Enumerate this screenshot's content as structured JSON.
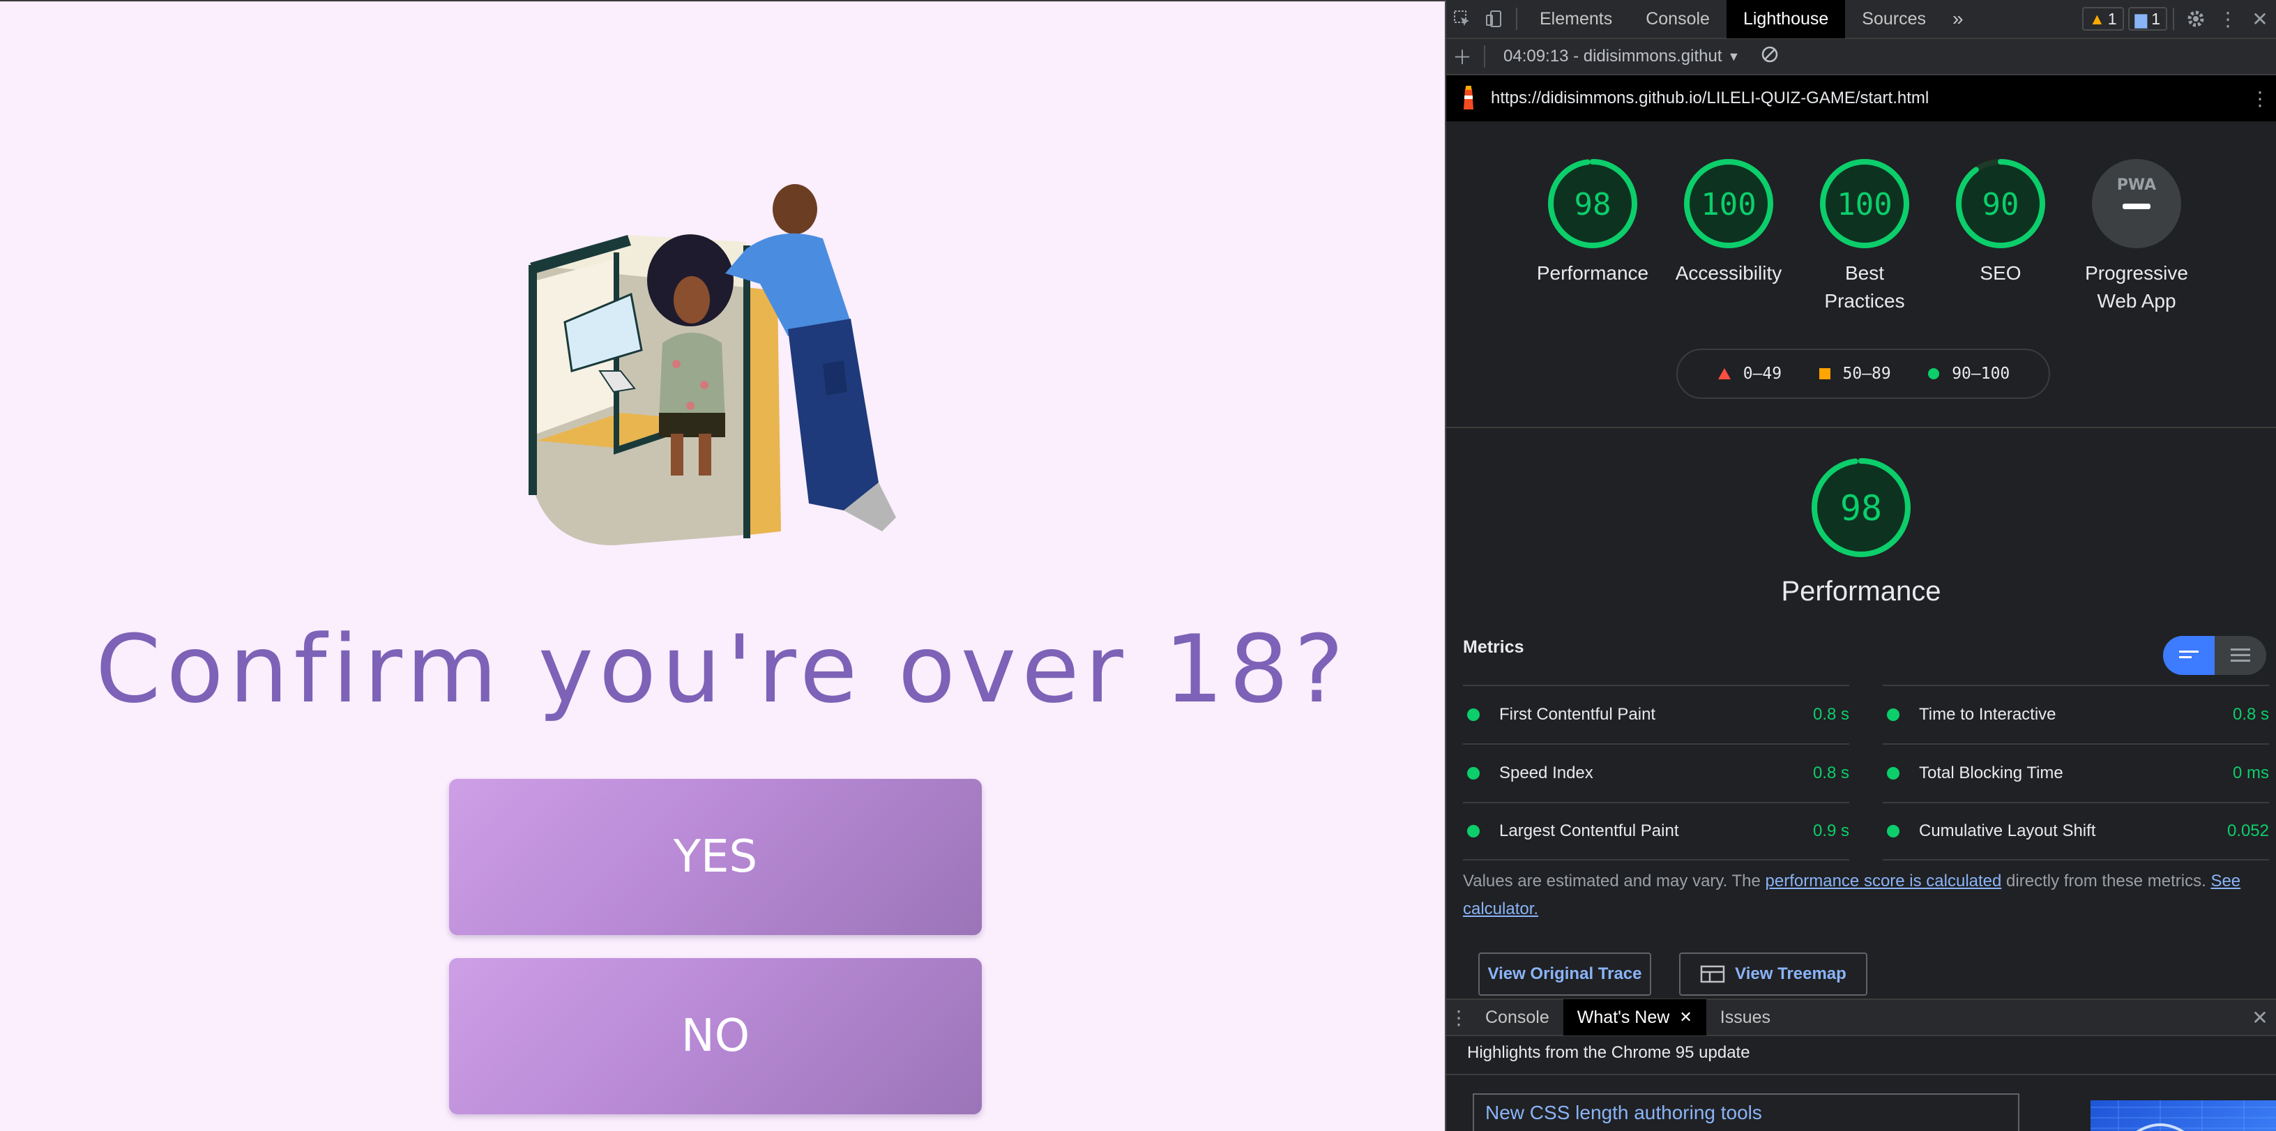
{
  "page": {
    "headline": "Confirm you're over 18?",
    "yes_label": "YES",
    "no_label": "NO"
  },
  "devtools": {
    "tabs": [
      "Elements",
      "Console",
      "Lighthouse",
      "Sources"
    ],
    "active_tab": "Lighthouse",
    "more_tabs": "»",
    "warnings_count": "1",
    "messages_count": "1",
    "report_selector": "04:09:13 - didisimmons.githut",
    "url": "https://didisimmons.github.io/LILELI-QUIZ-GAME/start.html",
    "scores": [
      {
        "value": "98",
        "label": "Performance",
        "score": 98
      },
      {
        "value": "100",
        "label": "Accessibility",
        "score": 100
      },
      {
        "value": "100",
        "label": "Best Practices",
        "score": 100
      },
      {
        "value": "90",
        "label": "SEO",
        "score": 90
      }
    ],
    "pwa": {
      "badge": "PWA",
      "label": "Progressive Web App"
    },
    "legend": [
      {
        "range": "0–49",
        "color": "#ff4e42"
      },
      {
        "range": "50–89",
        "color": "#ffa400"
      },
      {
        "range": "90–100",
        "color": "#0cce6b"
      }
    ],
    "performance": {
      "score": "98",
      "title": "Performance",
      "metrics_heading": "Metrics",
      "metrics_left": [
        {
          "name": "First Contentful Paint",
          "value": "0.8 s"
        },
        {
          "name": "Speed Index",
          "value": "0.8 s"
        },
        {
          "name": "Largest Contentful Paint",
          "value": "0.9 s"
        }
      ],
      "metrics_right": [
        {
          "name": "Time to Interactive",
          "value": "0.8 s"
        },
        {
          "name": "Total Blocking Time",
          "value": "0 ms"
        },
        {
          "name": "Cumulative Layout Shift",
          "value": "0.052"
        }
      ],
      "note_prefix": "Values are estimated and may vary. The ",
      "note_link1": "performance score is calculated",
      "note_middle": " directly from these metrics. ",
      "note_link2": "See calculator.",
      "btn_trace": "View Original Trace",
      "btn_treemap": "View Treemap"
    },
    "drawer": {
      "tabs": [
        "Console",
        "What's New",
        "Issues"
      ],
      "active_tab": "What's New",
      "highlights": "Highlights from the Chrome 95 update",
      "card_title": "New CSS length authoring tools"
    },
    "colors": {
      "pass": "#0cce6b",
      "accent": "#3d7bff",
      "link": "#8ab4f8"
    }
  }
}
